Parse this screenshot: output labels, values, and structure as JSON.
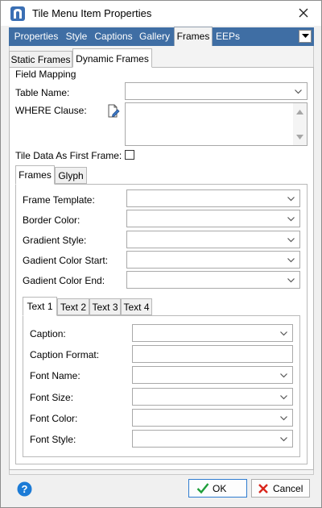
{
  "window": {
    "title": "Tile Menu Item Properties"
  },
  "main_tabs": [
    {
      "label": "Properties"
    },
    {
      "label": "Style"
    },
    {
      "label": "Captions"
    },
    {
      "label": "Gallery"
    },
    {
      "label": "Frames"
    },
    {
      "label": "EEPs"
    }
  ],
  "frame_tabs": [
    {
      "label": "Static Frames"
    },
    {
      "label": "Dynamic Frames"
    }
  ],
  "field_mapping": {
    "group_label": "Field Mapping",
    "table_name_label": "Table Name:",
    "table_name_value": "",
    "where_label": "WHERE Clause:",
    "where_value": "",
    "tile_data_label": "Tile Data As First Frame:",
    "tile_data_checked": false
  },
  "inner_tabs": [
    {
      "label": "Frames"
    },
    {
      "label": "Glyph"
    }
  ],
  "frames": {
    "fields": [
      {
        "label": "Frame Template:",
        "value": ""
      },
      {
        "label": "Border Color:",
        "value": ""
      },
      {
        "label": "Gradient Style:",
        "value": ""
      },
      {
        "label": "Gadient Color Start:",
        "value": ""
      },
      {
        "label": "Gadient Color End:",
        "value": ""
      }
    ]
  },
  "text_tabs": [
    {
      "label": "Text 1"
    },
    {
      "label": "Text 2"
    },
    {
      "label": "Text 3"
    },
    {
      "label": "Text 4"
    }
  ],
  "text_fields": [
    {
      "label": "Caption:",
      "value": "",
      "kind": "combo"
    },
    {
      "label": "Caption Format:",
      "value": "",
      "kind": "text"
    },
    {
      "label": "Font Name:",
      "value": "",
      "kind": "combo"
    },
    {
      "label": "Font Size:",
      "value": "",
      "kind": "combo"
    },
    {
      "label": "Font Color:",
      "value": "",
      "kind": "combo"
    },
    {
      "label": "Font Style:",
      "value": "",
      "kind": "combo"
    }
  ],
  "footer": {
    "ok_label": "OK",
    "cancel_label": "Cancel",
    "help_icon": "help-icon"
  },
  "colors": {
    "tab_strip": "#3f6ea4",
    "ok_check": "#1e9e3a",
    "cancel_x": "#d9261c",
    "help": "#1c7bd6"
  }
}
